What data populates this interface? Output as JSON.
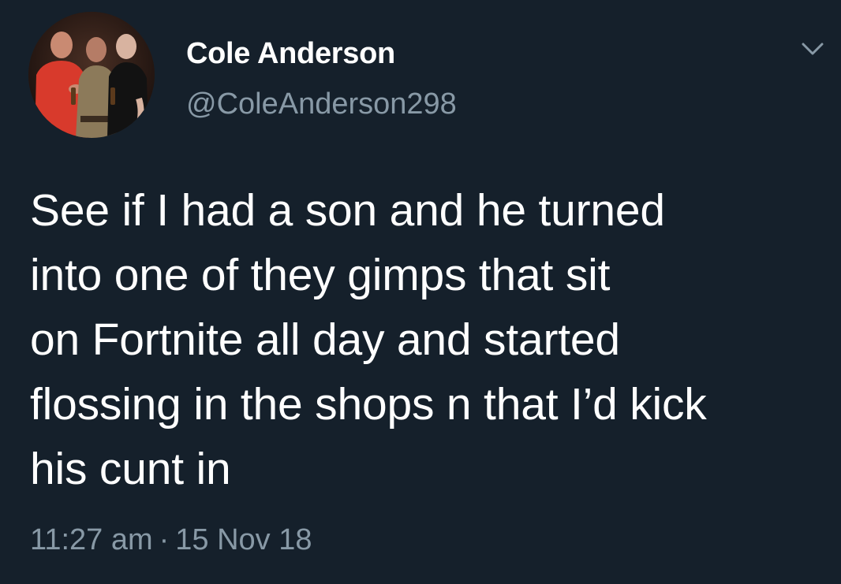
{
  "tweet": {
    "author": {
      "display_name": "Cole Anderson",
      "handle": "@ColeAnderson298",
      "avatar_icon": "group-photo-avatar"
    },
    "menu_icon": "chevron-down-icon",
    "text": "See if I had a son and he turned\ninto one of they gimps that sit\non Fortnite all day and started\nflossing in the shops n that I’d kick\nhis cunt in",
    "time": "11:27 am",
    "separator": "·",
    "date": "15 Nov 18"
  },
  "colors": {
    "background": "#15202b",
    "primary_text": "#ffffff",
    "secondary_text": "#8899a6"
  }
}
